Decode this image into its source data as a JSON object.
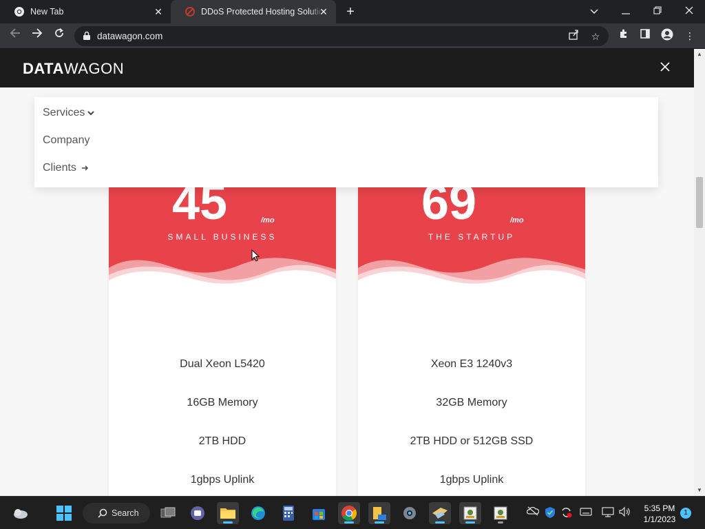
{
  "browser": {
    "tabs": [
      {
        "title": "New Tab",
        "favicon": "chrome-icon"
      },
      {
        "title": "DDoS Protected Hosting Solutions",
        "favicon": "datawagon-favicon"
      }
    ],
    "new_tab_icon": "plus-icon",
    "address": "datawagon.com"
  },
  "site": {
    "logo_bold": "DATA",
    "logo_light": "WAGON",
    "menu": [
      {
        "label": "Services",
        "icon": "chevron-down-icon"
      },
      {
        "label": "Company"
      },
      {
        "label": "Clients",
        "icon": "arrow-right-icon"
      }
    ],
    "accent": "#e8434b",
    "plans": [
      {
        "price": "45",
        "per": "/mo",
        "name": "SMALL BUSINESS",
        "features": [
          "Dual Xeon L5420",
          "16GB Memory",
          "2TB HDD",
          "1gbps Uplink"
        ]
      },
      {
        "price": "69",
        "per": "/mo",
        "name": "THE STARTUP",
        "features": [
          "Xeon E3 1240v3",
          "32GB Memory",
          "2TB HDD or 512GB SSD",
          "1gbps Uplink"
        ]
      }
    ]
  },
  "taskbar": {
    "search_label": "Search",
    "time": "5:35 PM",
    "date": "1/1/2023",
    "notifications": "1"
  }
}
